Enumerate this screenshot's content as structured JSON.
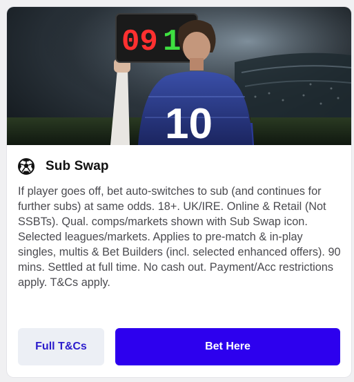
{
  "promo": {
    "image_board_text": "09 10",
    "image_shirt_number": "10",
    "icon": "football-icon",
    "title": "Sub Swap",
    "description": "If player goes off, bet auto-switches to sub (and continues for further subs) at same odds. 18+. UK/IRE. Online & Retail (Not SSBTs). Qual. comps/markets shown with Sub Swap icon. Selected leagues/markets. Applies to pre-match & in-play singles, multis & Bet Builders (incl. selected enhanced offers). 90 mins. Settled at full time. No cash out. Payment/Acc restrictions apply. T&Cs apply.",
    "terms_button": "Full T&Cs",
    "bet_button": "Bet Here"
  },
  "colors": {
    "accent": "#2d00ee",
    "secondary_button_bg": "#eceff5",
    "secondary_button_text": "#2b1ccc"
  }
}
